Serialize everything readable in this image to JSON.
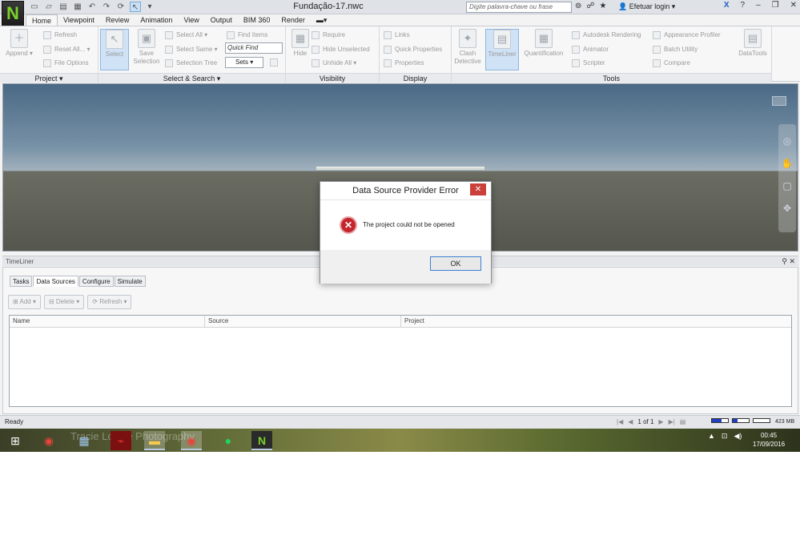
{
  "app": {
    "logo_letter": "N",
    "document_title": "Fundação-17.nwc",
    "search_placeholder": "Digite palavra-chave ou frase",
    "login_label": "Efetuar login"
  },
  "tabs": [
    "Home",
    "Viewpoint",
    "Review",
    "Animation",
    "View",
    "Output",
    "BIM 360",
    "Render"
  ],
  "active_tab": "Home",
  "ribbon": {
    "project": {
      "label": "Project",
      "append": "Append",
      "refresh": "Refresh",
      "reset_all": "Reset All...",
      "file_options": "File Options"
    },
    "select_search": {
      "label": "Select & Search",
      "select": "Select",
      "save_selection": "Save Selection",
      "select_all": "Select All",
      "select_same": "Select Same",
      "selection_tree": "Selection Tree",
      "find_items": "Find Items",
      "quick_find_placeholder": "Quick Find",
      "sets": "Sets"
    },
    "visibility": {
      "label": "Visibility",
      "hide": "Hide",
      "require": "Require",
      "hide_unselected": "Hide Unselected",
      "unhide_all": "Unhide All"
    },
    "display": {
      "label": "Display",
      "links": "Links",
      "quick_properties": "Quick Properties",
      "properties": "Properties"
    },
    "tools": {
      "label": "Tools",
      "clash_detective": "Clash Detective",
      "timeliner": "TimeLiner",
      "quantification": "Quantification",
      "autodesk_rendering": "Autodesk Rendering",
      "animator": "Animator",
      "scripter": "Scripter",
      "appearance_profiler": "Appearance Profiler",
      "batch_utility": "Batch Utility",
      "compare": "Compare",
      "datatools": "DataTools"
    }
  },
  "timeliner": {
    "title": "TimeLiner",
    "tabs": [
      "Tasks",
      "Data Sources",
      "Configure",
      "Simulate"
    ],
    "active_tab": "Data Sources",
    "toolbar": {
      "add": "Add",
      "delete": "Delete",
      "refresh": "Refresh"
    },
    "columns": [
      "Name",
      "Source",
      "Project"
    ]
  },
  "status": {
    "text": "Ready",
    "page": "1 of 1",
    "memory": "423 MB",
    "mem_fill_1": 0.6,
    "mem_fill_2": 0.3
  },
  "taskbar": {
    "watermark": "Tracie Louise Photography",
    "time": "00:45",
    "date": "17/09/2016"
  },
  "dialog": {
    "title": "Data Source Provider Error",
    "message": "The project could not be opened",
    "ok_label": "OK"
  }
}
